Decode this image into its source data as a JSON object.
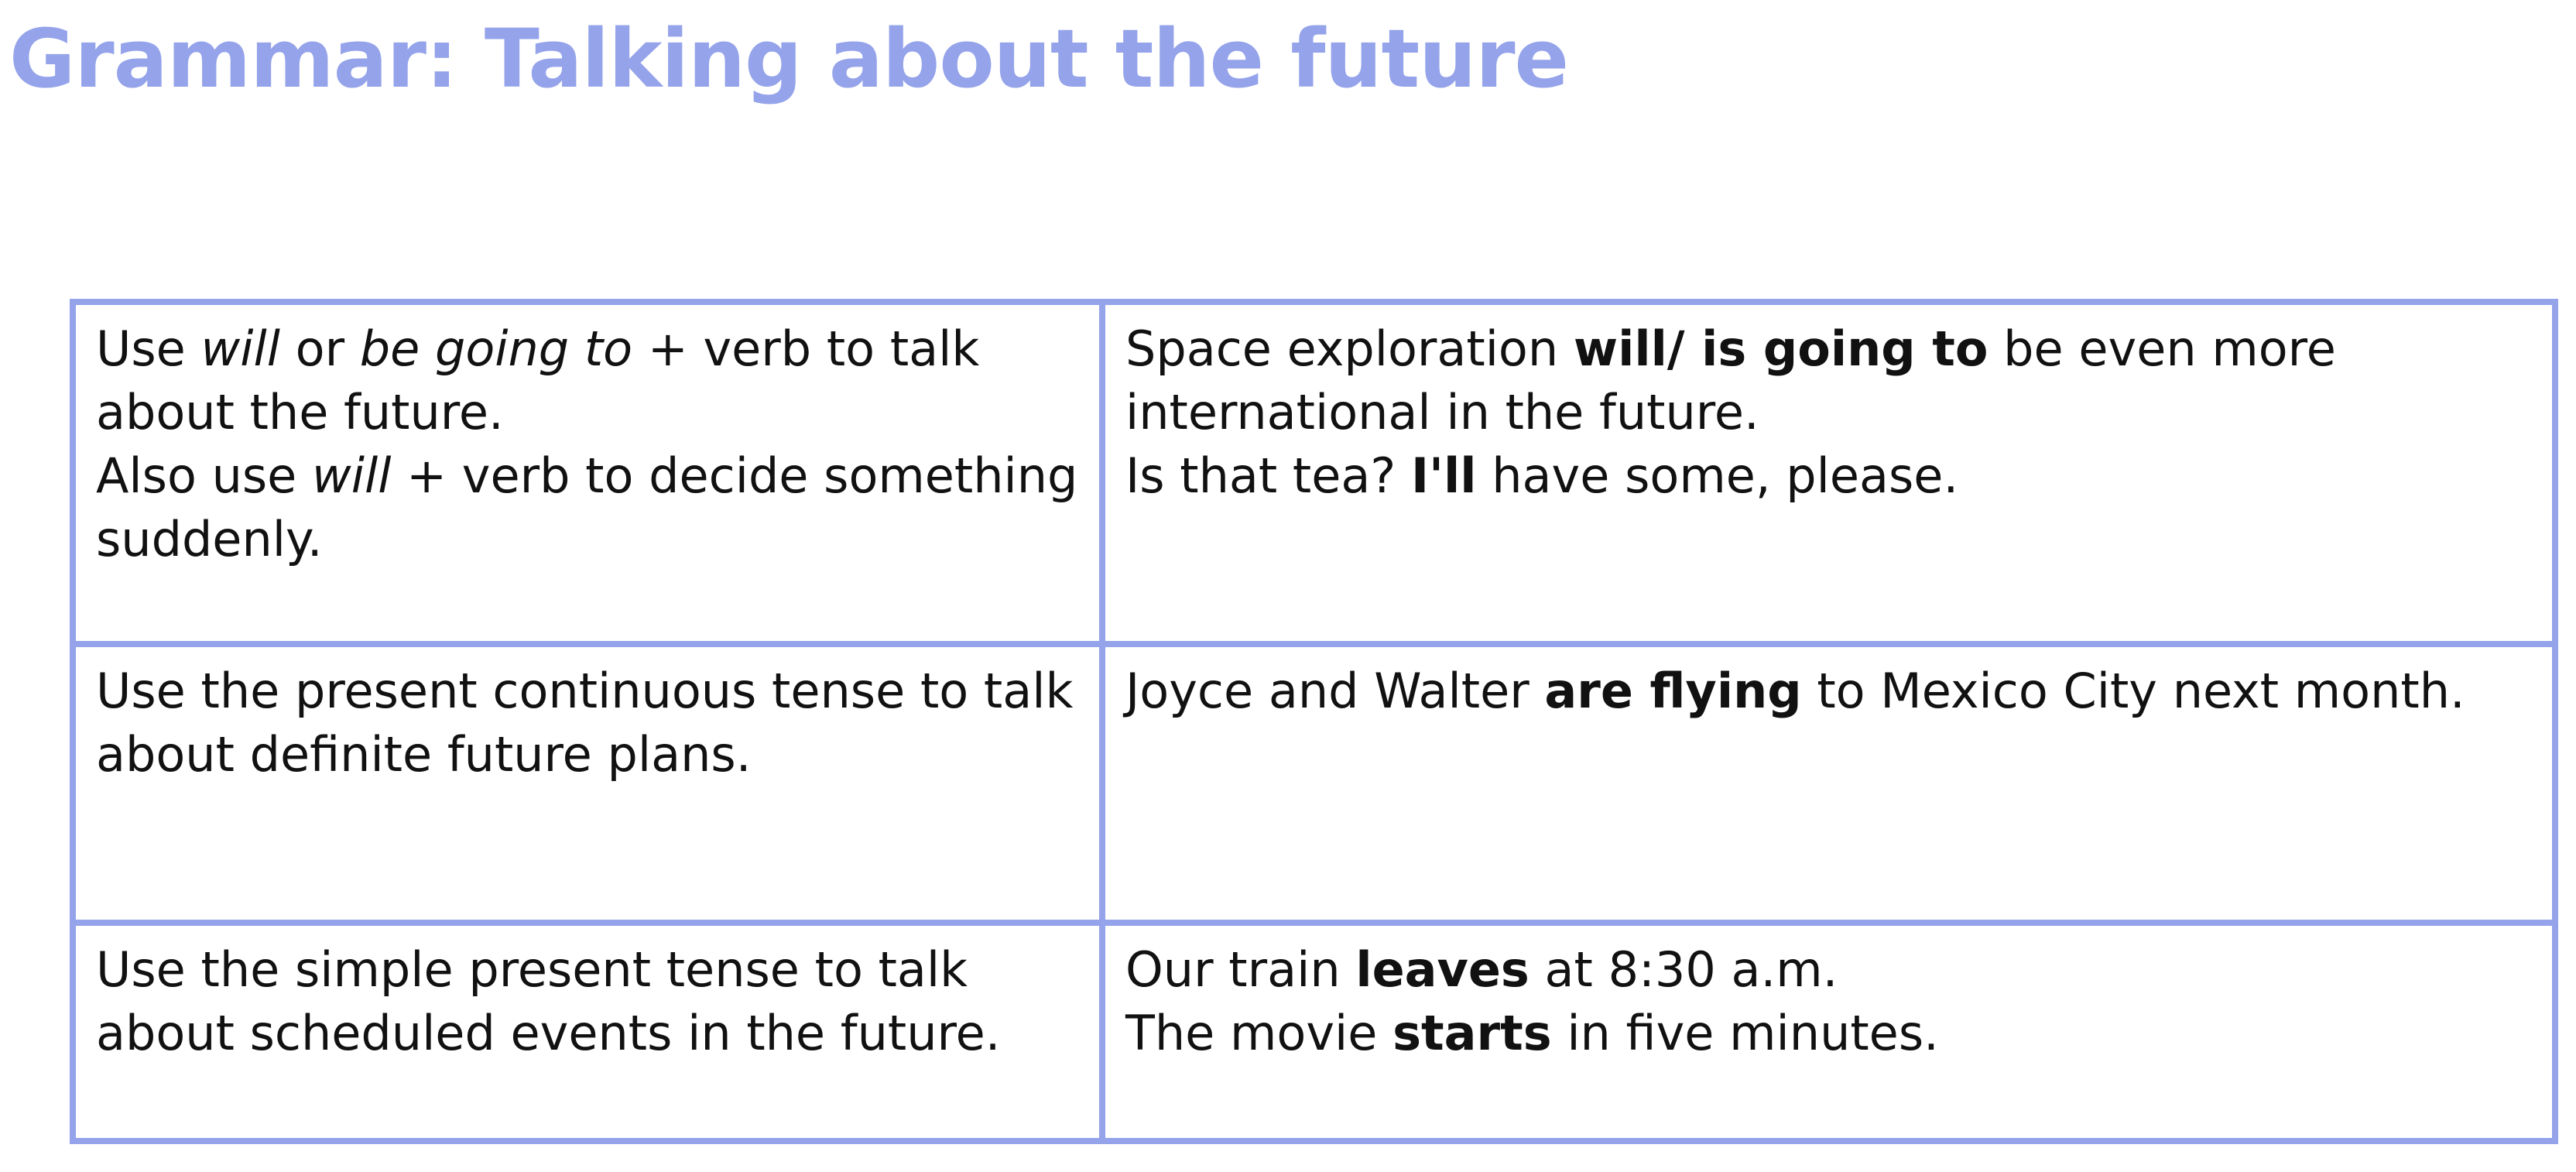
{
  "title": "Grammar: Talking about the future",
  "rows": [
    {
      "rule": {
        "line1": {
          "t0": "Use ",
          "i0": "will",
          "t1": " or ",
          "i1": "be going to",
          "t2": " + verb to talk about the future."
        },
        "line2": {
          "t0": "Also use ",
          "i0": "will",
          "t1": " + verb to decide something suddenly."
        }
      },
      "example": {
        "line1": {
          "t0": "Space exploration ",
          "b0": "will/ is going to",
          "t1": " be even more international in the future."
        },
        "line2": {
          "t0": "Is that tea? ",
          "b0": "I'll",
          "t1": " have some, please."
        }
      }
    },
    {
      "rule": {
        "line1": {
          "t0": "Use the present continuous tense to talk about definite future plans."
        }
      },
      "example": {
        "line1": {
          "t0": "Joyce and Walter ",
          "b0": "are flying",
          "t1": " to Mexico City next month."
        }
      }
    },
    {
      "rule": {
        "line1": {
          "t0": "Use the simple present tense to talk about scheduled events in the future."
        }
      },
      "example": {
        "line1": {
          "t0": "Our train ",
          "b0": "leaves",
          "t1": " at 8:30 a.m."
        },
        "line2": {
          "t0": "The movie ",
          "b0": "starts",
          "t1": " in five minutes."
        }
      }
    }
  ],
  "colors": {
    "accent": "#94a3ea",
    "text": "#111111"
  }
}
